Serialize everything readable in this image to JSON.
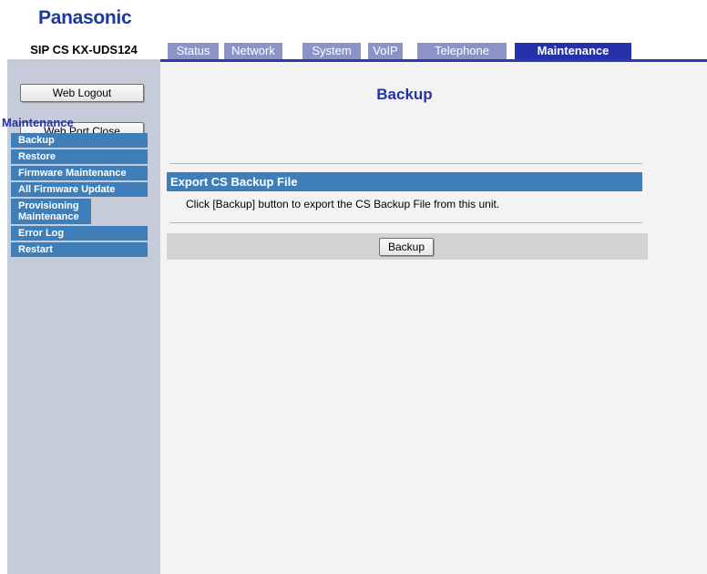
{
  "brand": {
    "logo": "Panasonic"
  },
  "device": {
    "model": "SIP CS KX-UDS124"
  },
  "tabs": [
    {
      "label": "Status"
    },
    {
      "label": "Network"
    },
    {
      "label": "System"
    },
    {
      "label": "VoIP"
    },
    {
      "label": "Telephone"
    },
    {
      "label": "Maintenance",
      "active": true
    }
  ],
  "sidebar": {
    "web_logout": "Web Logout",
    "web_port_close": "Web Port Close",
    "section_title": "Maintenance",
    "items": [
      {
        "label": "Backup"
      },
      {
        "label": "Restore"
      },
      {
        "label": "Firmware Maintenance"
      },
      {
        "label": "All Firmware Update"
      },
      {
        "label": "Provisioning Maintenance"
      },
      {
        "label": "Error Log"
      },
      {
        "label": "Restart"
      }
    ]
  },
  "main": {
    "page_title": "Backup",
    "section_title": "Export CS Backup File",
    "description": "Click [Backup] button to export the CS Backup File from this unit.",
    "backup_button": "Backup"
  },
  "colors": {
    "tab_inactive": "#8c93c7",
    "tab_active": "#2431a8",
    "menu_item": "#3f7fb9",
    "sidebar_bg": "#c5cbd8",
    "content_bg": "#f3f3f3",
    "title_blue": "#2533a4"
  }
}
